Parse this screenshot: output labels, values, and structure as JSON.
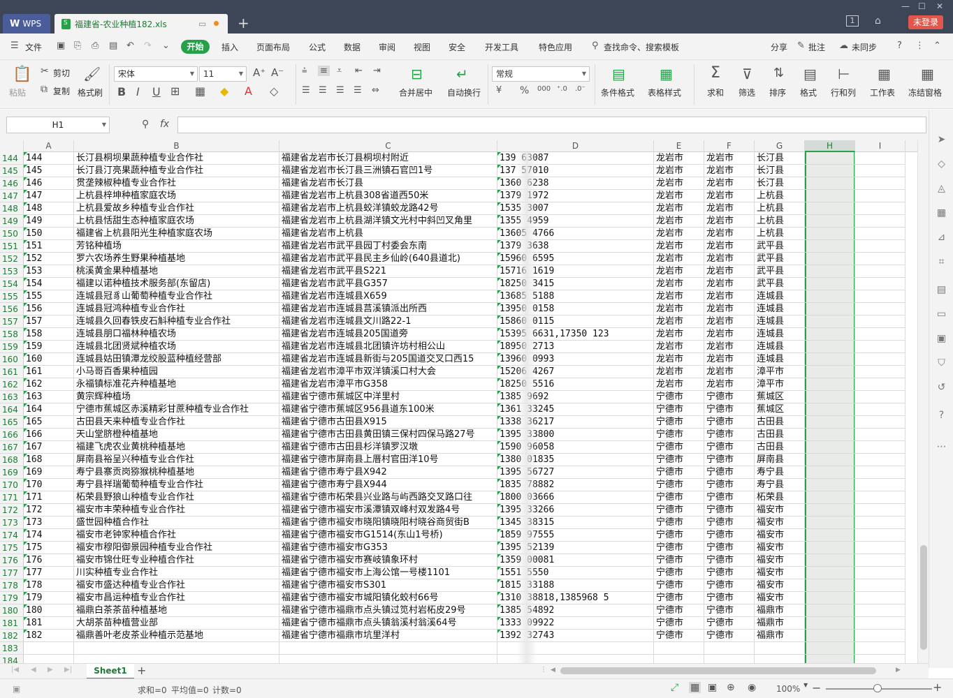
{
  "titlebar": {
    "app_tab": "WPS",
    "doc_tab": "福建省-农业种植182.xls",
    "page_num": "1",
    "login": "未登录"
  },
  "menubar": {
    "file": "文件",
    "start": "开始",
    "items": [
      "插入",
      "页面布局",
      "公式",
      "数据",
      "审阅",
      "视图",
      "安全",
      "开发工具",
      "特色应用"
    ],
    "search": "查找命令、搜索模板",
    "share": "分享",
    "comment": "批注",
    "sync": "未同步"
  },
  "ribbon": {
    "paste": "粘贴",
    "cut": "剪切",
    "copy": "复制",
    "format_painter": "格式刷",
    "font_name": "宋体",
    "font_size": "11",
    "merge_center": "合并居中",
    "wrap_text": "自动换行",
    "number_format": "常规",
    "cond_format": "条件格式",
    "table_style": "表格样式",
    "sum": "求和",
    "filter": "筛选",
    "sort": "排序",
    "format": "格式",
    "row_col": "行和列",
    "worksheet": "工作表",
    "freeze": "冻结窗格"
  },
  "formula": {
    "name_box": "H1",
    "fx": "fx",
    "value": ""
  },
  "columns": [
    "A",
    "B",
    "C",
    "D",
    "E",
    "F",
    "G",
    "H",
    "I"
  ],
  "selected_column": "H",
  "rows": [
    {
      "n": "144",
      "a": "144",
      "b": "长汀县桐坝果蔬种植专业合作社",
      "c": "福建省龙岩市长汀县桐坝村附近",
      "d": "139     63087",
      "e": "龙岩市",
      "f": "龙岩市",
      "g": "长汀县"
    },
    {
      "n": "145",
      "a": "145",
      "b": "长汀县汀亮果蔬种植专业合作社",
      "c": "福建省龙岩市长汀县三洲镇石官凹1号",
      "d": "137    57010",
      "e": "龙岩市",
      "f": "龙岩市",
      "g": "长汀县"
    },
    {
      "n": "146",
      "a": "146",
      "b": "贯垄辣椒种植专业合作社",
      "c": "福建省龙岩市长汀县",
      "d": "1360    6238",
      "e": "龙岩市",
      "f": "龙岩市",
      "g": "长汀县"
    },
    {
      "n": "147",
      "a": "147",
      "b": "上杭县梓坤种植家庭农场",
      "c": "福建省龙岩市上杭县308省道西50米",
      "d": "1379    1972",
      "e": "龙岩市",
      "f": "龙岩市",
      "g": "上杭县"
    },
    {
      "n": "148",
      "a": "148",
      "b": "上杭县爱故乡种植专业合作社",
      "c": "福建省龙岩市上杭县蛟洋镇蛟龙路42号",
      "d": "1535    3007",
      "e": "龙岩市",
      "f": "龙岩市",
      "g": "上杭县"
    },
    {
      "n": "149",
      "a": "149",
      "b": "上杭县恬甜生态种植家庭农场",
      "c": "福建省龙岩市上杭县湖洋镇文光村中斜凹叉角里",
      "d": "1355    4959",
      "e": "龙岩市",
      "f": "龙岩市",
      "g": "上杭县"
    },
    {
      "n": "150",
      "a": "150",
      "b": "福建省上杭县阳光生种植家庭农场",
      "c": "福建省龙岩市上杭县",
      "d": "13605    4766",
      "e": "龙岩市",
      "f": "龙岩市",
      "g": "上杭县"
    },
    {
      "n": "151",
      "a": "151",
      "b": "芳铭种植场",
      "c": "福建省龙岩市武平县园丁村委会东南",
      "d": "1379    3638",
      "e": "龙岩市",
      "f": "龙岩市",
      "g": "武平县"
    },
    {
      "n": "152",
      "a": "152",
      "b": "罗六农场养生野果种植基地",
      "c": "福建省龙岩市武平县民主乡仙岭(640县道北)",
      "d": "15960    6595",
      "e": "龙岩市",
      "f": "龙岩市",
      "g": "武平县"
    },
    {
      "n": "153",
      "a": "153",
      "b": "桃溪黄金果种植基地",
      "c": "福建省龙岩市武平县S221",
      "d": "15716    1619",
      "e": "龙岩市",
      "f": "龙岩市",
      "g": "武平县"
    },
    {
      "n": "154",
      "a": "154",
      "b": "福建以诺种植技术服务部(东留店)",
      "c": "福建省龙岩市武平县G357",
      "d": "18250    3415",
      "e": "龙岩市",
      "f": "龙岩市",
      "g": "武平县"
    },
    {
      "n": "155",
      "a": "155",
      "b": "连城县冠豸山葡萄种植专业合作社",
      "c": "福建省龙岩市连城县X659",
      "d": "13685    5188",
      "e": "龙岩市",
      "f": "龙岩市",
      "g": "连城县"
    },
    {
      "n": "156",
      "a": "156",
      "b": "连城县冠鸿种植专业合作社",
      "c": "福建省龙岩市连城县莒溪镇派出所西",
      "d": "13950    0158",
      "e": "龙岩市",
      "f": "龙岩市",
      "g": "连城县"
    },
    {
      "n": "157",
      "a": "157",
      "b": "连城县久回春铁皮石斛种植专业合作社",
      "c": "福建省龙岩市连城县文川路22-1",
      "d": "15860    0115",
      "e": "龙岩市",
      "f": "龙岩市",
      "g": "连城县"
    },
    {
      "n": "158",
      "a": "158",
      "b": "连城县朋口福林种植农场",
      "c": "福建省龙岩市连城县205国道旁",
      "d": "15395    6631,17350    123",
      "e": "龙岩市",
      "f": "龙岩市",
      "g": "连城县"
    },
    {
      "n": "159",
      "a": "159",
      "b": "连城县北团贤斌种植农场",
      "c": "福建省龙岩市连城县北团镇许坊村相公山",
      "d": "18950    2713",
      "e": "龙岩市",
      "f": "龙岩市",
      "g": "连城县"
    },
    {
      "n": "160",
      "a": "160",
      "b": "连城县姑田镇潭龙绞股蓝种植经营部",
      "c": "福建省龙岩市连城县新街与205国道交叉口西15",
      "d": "13960    0993",
      "e": "龙岩市",
      "f": "龙岩市",
      "g": "连城县"
    },
    {
      "n": "161",
      "a": "161",
      "b": "小马哥百香果种植园",
      "c": "福建省龙岩市漳平市双洋镇溪口村大会",
      "d": "15206    4267",
      "e": "龙岩市",
      "f": "龙岩市",
      "g": "漳平市"
    },
    {
      "n": "162",
      "a": "162",
      "b": "永福镇标准花卉种植基地",
      "c": "福建省龙岩市漳平市G358",
      "d": "18250    5516",
      "e": "龙岩市",
      "f": "龙岩市",
      "g": "漳平市"
    },
    {
      "n": "163",
      "a": "163",
      "b": "黄宗辉种植场",
      "c": "福建省宁德市蕉城区中洋里村",
      "d": "1385    9692",
      "e": "宁德市",
      "f": "宁德市",
      "g": "蕉城区"
    },
    {
      "n": "164",
      "a": "164",
      "b": "宁德市蕉城区赤溪精彩甘蔗种植专业合作社",
      "c": "福建省宁德市蕉城区956县道东100米",
      "d": "1361    33245",
      "e": "宁德市",
      "f": "宁德市",
      "g": "蕉城区"
    },
    {
      "n": "165",
      "a": "165",
      "b": "古田县天来种植专业合作社",
      "c": "福建省宁德市古田县X915",
      "d": "1338    36217",
      "e": "宁德市",
      "f": "宁德市",
      "g": "古田县"
    },
    {
      "n": "166",
      "a": "166",
      "b": "天山堂脐橙种植基地",
      "c": "福建省宁德市古田县黄田镇三保村四保马路27号",
      "d": "1395    33800",
      "e": "宁德市",
      "f": "宁德市",
      "g": "古田县"
    },
    {
      "n": "167",
      "a": "167",
      "b": "福建飞虎农业黄桃种植基地",
      "c": "福建省宁德市古田县杉洋镇罗汉墩",
      "d": "1590    96058",
      "e": "宁德市",
      "f": "宁德市",
      "g": "古田县"
    },
    {
      "n": "168",
      "a": "168",
      "b": "屏南县裕呈兴种植专业合作社",
      "c": "福建省宁德市屏南县上厝村官田洋10号",
      "d": "1380    01835",
      "e": "宁德市",
      "f": "宁德市",
      "g": "屏南县"
    },
    {
      "n": "169",
      "a": "169",
      "b": "寿宁县寨贡岗猕猴桃种植基地",
      "c": "福建省宁德市寿宁县X942",
      "d": "1395    56727",
      "e": "宁德市",
      "f": "宁德市",
      "g": "寿宁县"
    },
    {
      "n": "170",
      "a": "170",
      "b": "寿宁县祥瑞葡萄种植专业合作社",
      "c": "福建省宁德市寿宁县X944",
      "d": "1835    78882",
      "e": "宁德市",
      "f": "宁德市",
      "g": "寿宁县"
    },
    {
      "n": "171",
      "a": "171",
      "b": "柘荣县野狼山种植专业合作社",
      "c": "福建省宁德市柘荣县兴业路与屿西路交叉路口往",
      "d": "1800    03666",
      "e": "宁德市",
      "f": "宁德市",
      "g": "柘荣县"
    },
    {
      "n": "172",
      "a": "172",
      "b": "福安市丰荣种植专业合作社",
      "c": "福建省宁德市福安市溪潭镇双峰村双发路4号",
      "d": "1395    33266",
      "e": "宁德市",
      "f": "宁德市",
      "g": "福安市"
    },
    {
      "n": "173",
      "a": "173",
      "b": "盛世园种植合作社",
      "c": "福建省宁德市福安市晓阳镇晓阳村晓谷商贸街B",
      "d": "1345    38315",
      "e": "宁德市",
      "f": "宁德市",
      "g": "福安市"
    },
    {
      "n": "174",
      "a": "174",
      "b": "福安市老钟家种植合作社",
      "c": "福建省宁德市福安市G1514(东山1号桥)",
      "d": "1859    97555",
      "e": "宁德市",
      "f": "宁德市",
      "g": "福安市"
    },
    {
      "n": "175",
      "a": "175",
      "b": "福安市穆阳御景园种植专业合作社",
      "c": "福建省宁德市福安市G353",
      "d": "1395    52139",
      "e": "宁德市",
      "f": "宁德市",
      "g": "福安市"
    },
    {
      "n": "176",
      "a": "176",
      "b": "福安市锦仕旺专业种植合作社",
      "c": "福建省宁德市福安市赛岐镇象环村",
      "d": "1359    00081",
      "e": "宁德市",
      "f": "宁德市",
      "g": "福安市"
    },
    {
      "n": "177",
      "a": "177",
      "b": "川实种植专业合作社",
      "c": "福建省宁德市福安市上海公馆一号楼1101",
      "d": "1551    5550",
      "e": "宁德市",
      "f": "宁德市",
      "g": "福安市"
    },
    {
      "n": "178",
      "a": "178",
      "b": "福安市盛达种植专业合作社",
      "c": "福建省宁德市福安市S301",
      "d": "1815    33188",
      "e": "宁德市",
      "f": "宁德市",
      "g": "福安市"
    },
    {
      "n": "179",
      "a": "179",
      "b": "福安市昌运种植专业合作社",
      "c": "福建省宁德市福安市城阳镇化蛟村66号",
      "d": "1310    38818,1385968    5",
      "e": "宁德市",
      "f": "宁德市",
      "g": "福安市"
    },
    {
      "n": "180",
      "a": "180",
      "b": "福鼎白茶茶苗种植基地",
      "c": "福建省宁德市福鼎市点头镇过笕村岩柘皮29号",
      "d": "1385    54892",
      "e": "宁德市",
      "f": "宁德市",
      "g": "福鼎市"
    },
    {
      "n": "181",
      "a": "181",
      "b": "大胡茶苗种植营业部",
      "c": "福建省宁德市福鼎市点头镇翁溪村翁溪64号",
      "d": "1333    09922",
      "e": "宁德市",
      "f": "宁德市",
      "g": "福鼎市"
    },
    {
      "n": "182",
      "a": "182",
      "b": "福鼎善叶老皮茶业种植示范基地",
      "c": "福建省宁德市福鼎市坑里洋村",
      "d": "1392    32743",
      "e": "宁德市",
      "f": "宁德市",
      "g": "福鼎市"
    },
    {
      "n": "183",
      "a": "",
      "b": "",
      "c": "",
      "d": "",
      "e": "",
      "f": "",
      "g": ""
    },
    {
      "n": "184",
      "a": "",
      "b": "",
      "c": "",
      "d": "",
      "e": "",
      "f": "",
      "g": ""
    }
  ],
  "sheetbar": {
    "sheet_name": "Sheet1",
    "add": "+"
  },
  "statusbar": {
    "sum": "求和=0",
    "avg": "平均值=0",
    "count": "计数=0",
    "zoom": "100%"
  },
  "colors": {
    "accent": "#27a149",
    "titlebar": "#3c4656",
    "login": "#e2574c"
  }
}
